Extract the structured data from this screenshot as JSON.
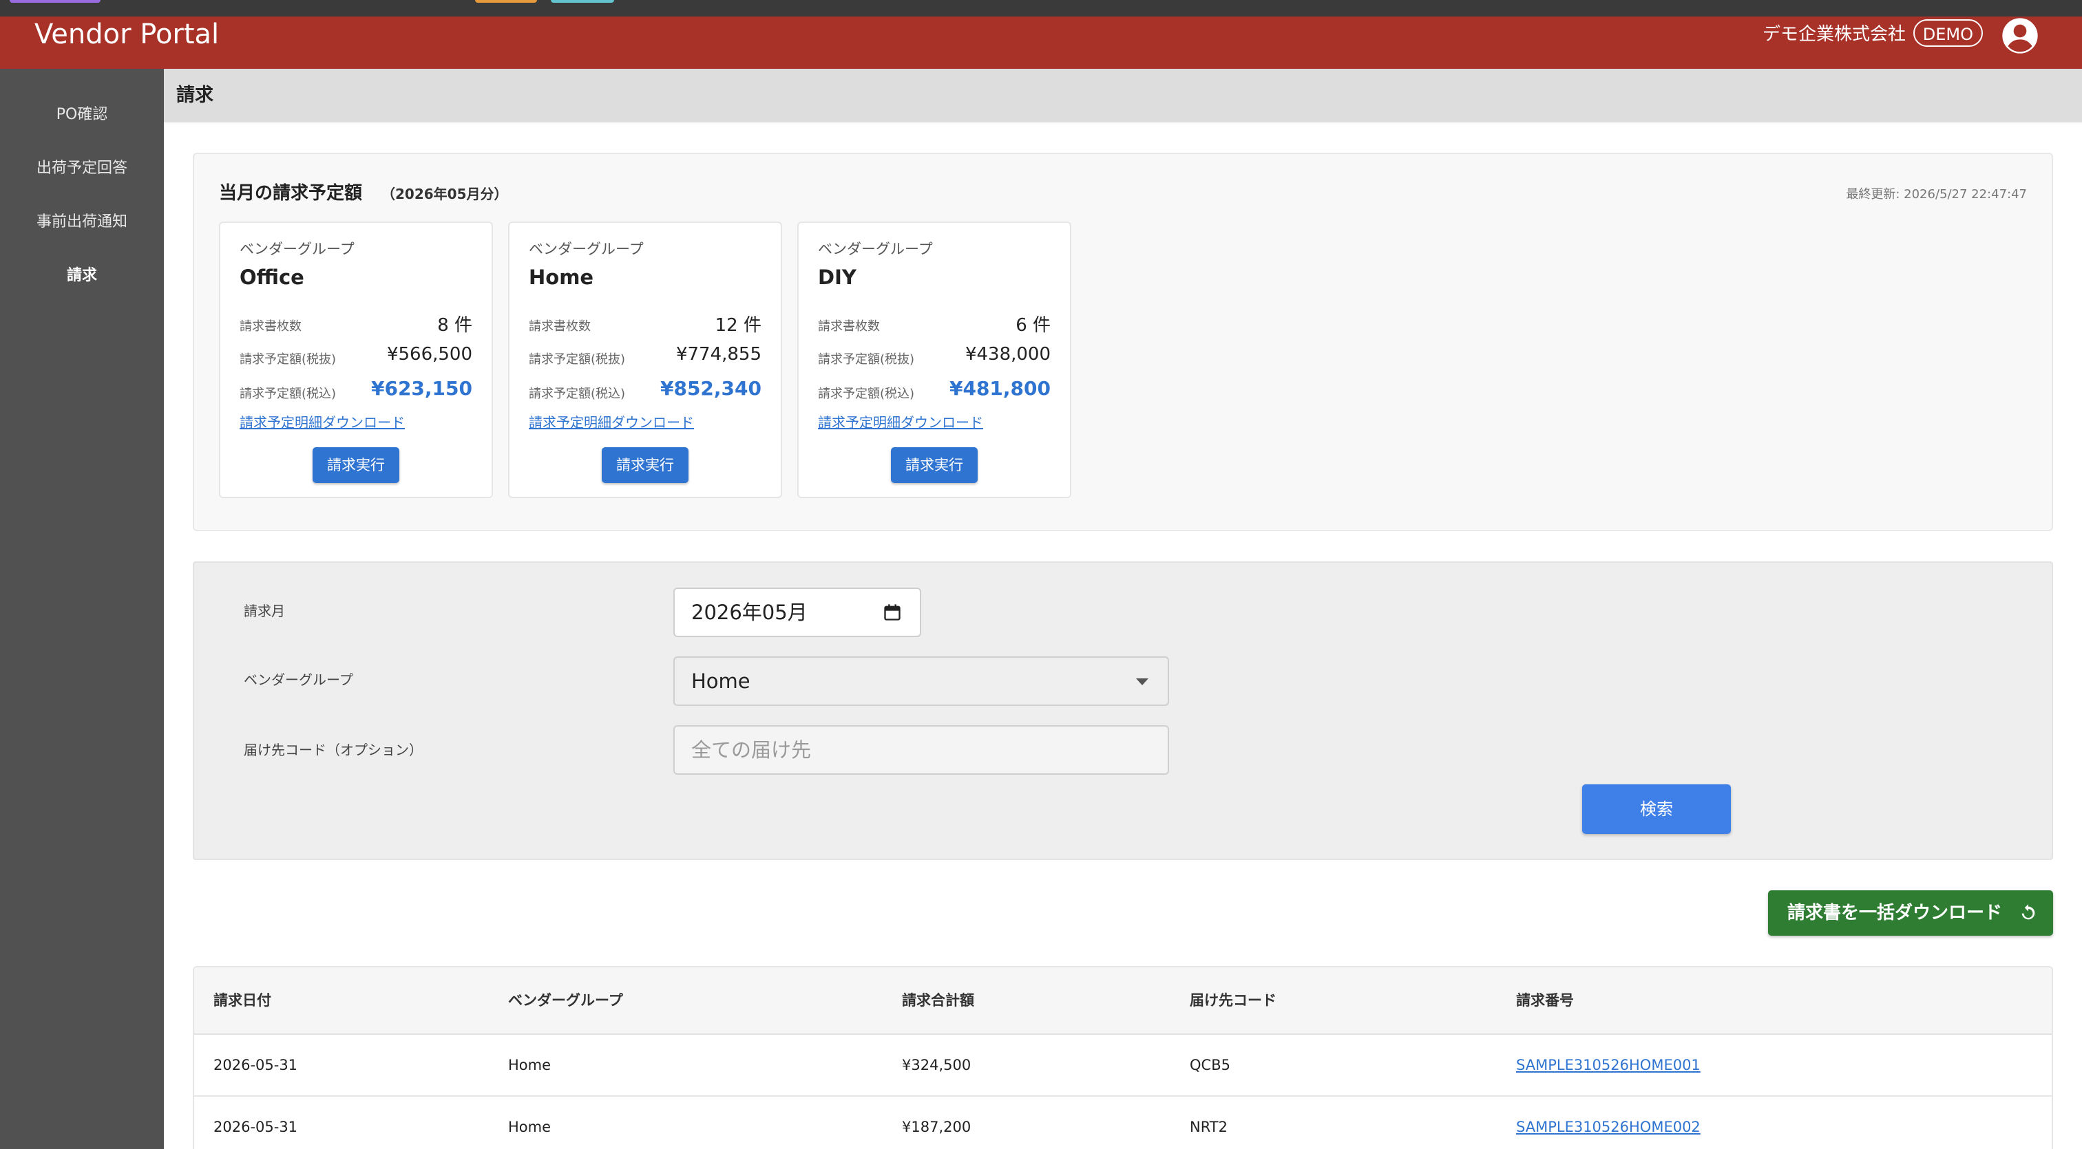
{
  "app": {
    "title": "Vendor Portal",
    "company": "デモ企業株式会社",
    "badge": "DEMO"
  },
  "sidebar": {
    "items": [
      {
        "label": "PO確認",
        "active": false
      },
      {
        "label": "出荷予定回答",
        "active": false
      },
      {
        "label": "事前出荷通知",
        "active": false
      },
      {
        "label": "請求",
        "active": true
      }
    ]
  },
  "page": {
    "title": "請求"
  },
  "summary": {
    "title": "当月の請求予定額",
    "period": "（2026年05月分）",
    "last_updated": "最終更新: 2026/5/27 22:47:47",
    "cards": [
      {
        "group_label": "ベンダーグループ",
        "name": "Office",
        "count_label": "請求書枚数",
        "count": "8 件",
        "excl_label": "請求予定額(税抜)",
        "excl": "¥566,500",
        "incl_label": "請求予定額(税込)",
        "incl": "¥623,150",
        "link": "請求予定明細ダウンロード",
        "button": "請求実行"
      },
      {
        "group_label": "ベンダーグループ",
        "name": "Home",
        "count_label": "請求書枚数",
        "count": "12 件",
        "excl_label": "請求予定額(税抜)",
        "excl": "¥774,855",
        "incl_label": "請求予定額(税込)",
        "incl": "¥852,340",
        "link": "請求予定明細ダウンロード",
        "button": "請求実行"
      },
      {
        "group_label": "ベンダーグループ",
        "name": "DIY",
        "count_label": "請求書枚数",
        "count": "6 件",
        "excl_label": "請求予定額(税抜)",
        "excl": "¥438,000",
        "incl_label": "請求予定額(税込)",
        "incl": "¥481,800",
        "link": "請求予定明細ダウンロード",
        "button": "請求実行"
      }
    ]
  },
  "search": {
    "month_label": "請求月",
    "month_value": "2026年05月",
    "group_label": "ベンダーグループ",
    "group_value": "Home",
    "dest_label": "届け先コード（オプション）",
    "dest_placeholder": "全ての届け先",
    "button": "検索"
  },
  "bulk_download": {
    "label": "請求書を一括ダウンロード"
  },
  "table": {
    "headers": [
      "請求日付",
      "ベンダーグループ",
      "請求合計額",
      "届け先コード",
      "請求番号"
    ],
    "rows": [
      [
        "2026-05-31",
        "Home",
        "¥324,500",
        "QCB5",
        "SAMPLE310526HOME001"
      ],
      [
        "2026-05-31",
        "Home",
        "¥187,200",
        "NRT2",
        "SAMPLE310526HOME002"
      ]
    ]
  },
  "colors": {
    "header": "#a83128",
    "sidebar": "#515151",
    "primary": "#2f74d0",
    "success": "#2e7d32",
    "search": "#3f7fe8"
  },
  "icons": {
    "user": "account-circle-icon",
    "calendar": "calendar-icon",
    "caret": "dropdown-caret-icon",
    "refresh": "refresh-icon"
  }
}
